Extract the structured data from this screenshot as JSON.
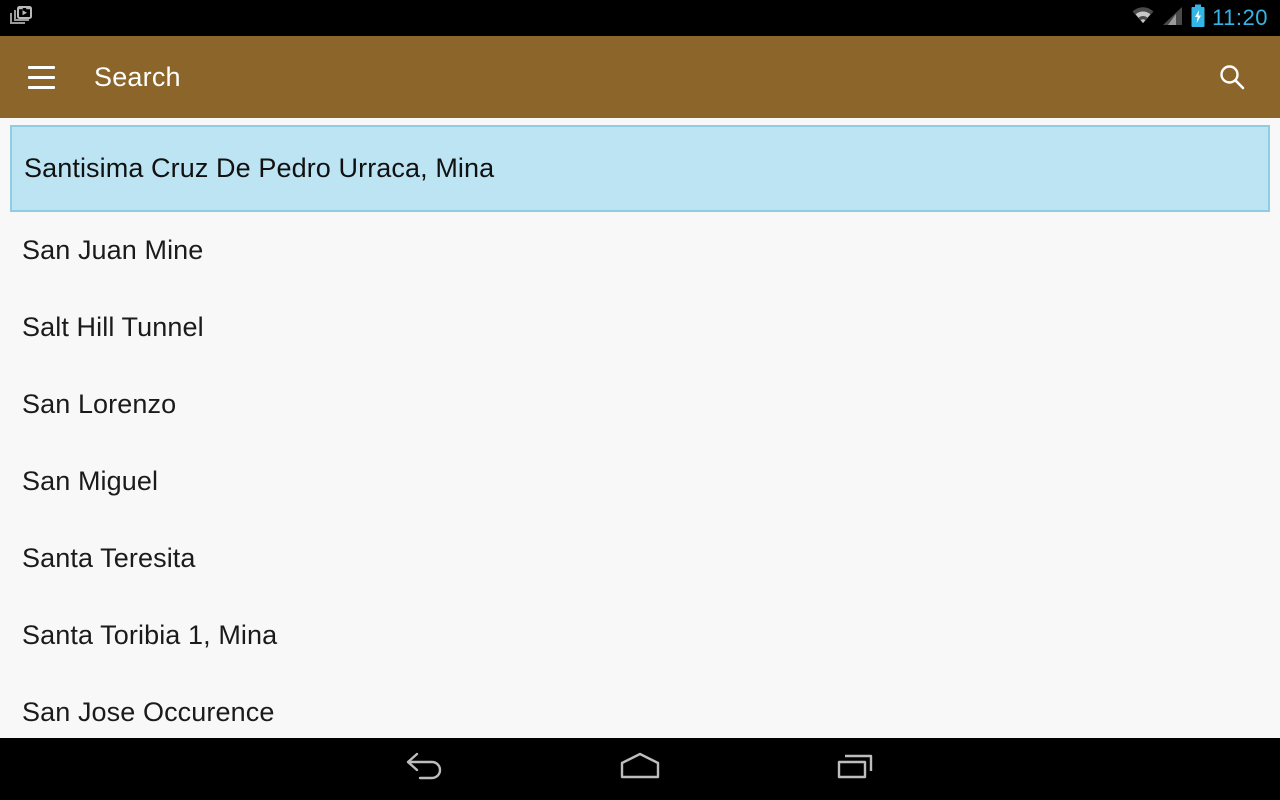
{
  "status_bar": {
    "notification_icon": "screen-record-icon",
    "wifi_icon": "wifi-icon",
    "signal_icon": "cell-signal-icon",
    "battery_icon": "battery-charging-icon",
    "time": "11:20",
    "accent_color": "#33B5E5",
    "background_color": "#000000"
  },
  "app_bar": {
    "menu_icon": "hamburger-menu-icon",
    "title": "Search",
    "search_icon": "search-icon",
    "background_color": "#8B6529",
    "text_color": "#FFFFFF"
  },
  "content": {
    "background_color": "#F8F8F8",
    "selected_index": 0,
    "selected_background": "#BCE4F2",
    "selected_border": "#8FCDE3",
    "results": [
      {
        "label": "Santisima Cruz De Pedro Urraca, Mina",
        "selected": true
      },
      {
        "label": "San Juan Mine",
        "selected": false
      },
      {
        "label": "Salt Hill Tunnel",
        "selected": false
      },
      {
        "label": "San Lorenzo",
        "selected": false
      },
      {
        "label": "San Miguel",
        "selected": false
      },
      {
        "label": "Santa Teresita",
        "selected": false
      },
      {
        "label": "Santa Toribia 1, Mina",
        "selected": false
      },
      {
        "label": "San Jose Occurence",
        "selected": false
      }
    ]
  },
  "nav_bar": {
    "background_color": "#000000",
    "buttons": [
      {
        "name": "back-button",
        "icon": "back-arrow-icon"
      },
      {
        "name": "home-button",
        "icon": "home-icon"
      },
      {
        "name": "recents-button",
        "icon": "recent-apps-icon"
      }
    ]
  }
}
